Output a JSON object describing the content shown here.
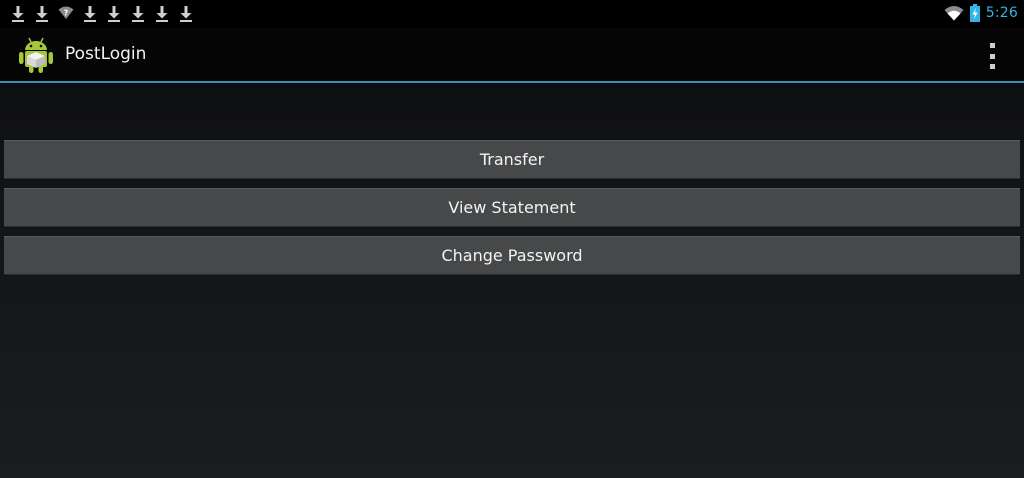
{
  "status_bar": {
    "notification_icons": [
      "download-icon",
      "download-icon",
      "wifi-question-icon",
      "download-icon",
      "download-icon",
      "download-icon",
      "download-icon",
      "download-icon"
    ],
    "time": "5:26",
    "wifi_icon": "wifi-icon",
    "battery_icon": "battery-charging-icon",
    "accent_color": "#33b5e5"
  },
  "action_bar": {
    "app_icon": "android-app-icon",
    "title": "PostLogin",
    "overflow_icon": "overflow-menu-icon",
    "divider_color": "#3a91b4"
  },
  "buttons": [
    {
      "label": "Transfer"
    },
    {
      "label": "View Statement"
    },
    {
      "label": "Change Password"
    }
  ]
}
